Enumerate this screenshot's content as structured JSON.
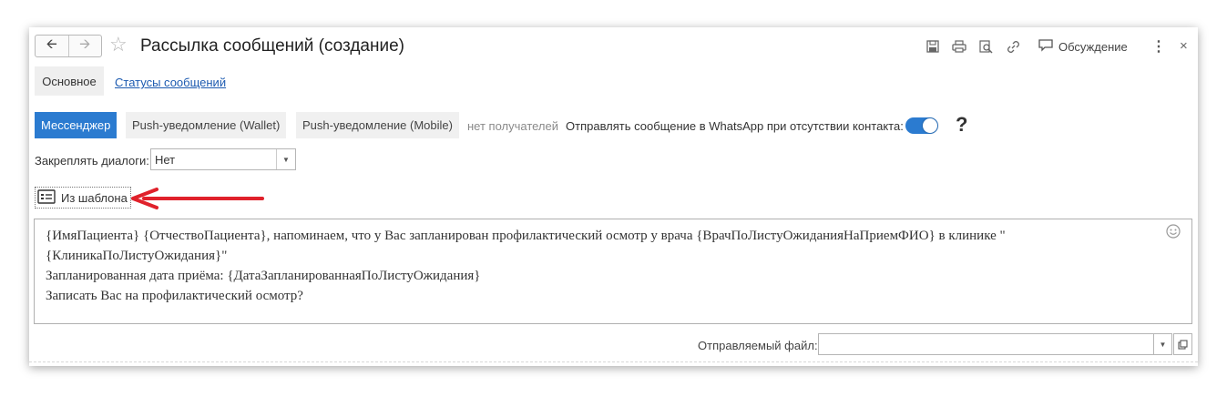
{
  "window": {
    "title": "Рассылка сообщений (создание)",
    "discussion_label": "Обсуждение"
  },
  "tabs": {
    "main": "Основное",
    "statuses": "Статусы сообщений"
  },
  "modes": [
    {
      "label": "Мессенджер",
      "active": true
    },
    {
      "label": "Push-уведомление (Wallet)",
      "active": false
    },
    {
      "label": "Push-уведомление (Mobile)",
      "active": false
    }
  ],
  "recipients_status": "нет получателей",
  "whatsapp": {
    "label": "Отправлять сообщение в WhatsApp при отсутствии контакта:",
    "enabled": true
  },
  "help_label": "?",
  "pin_dialogs": {
    "label": "Закреплять диалоги:",
    "value": "Нет"
  },
  "template_button": "Из шаблона",
  "message_lines": [
    "{ИмяПациента} {ОтчествоПациента}, напоминаем, что у Вас запланирован профилактический осмотр у врача {ВрачПоЛистуОжиданияНаПриемФИО} в клинике \"",
    "{КлиникаПоЛистуОжидания}\"",
    "Запланированная дата приёма: {ДатаЗапланированнаяПоЛистуОжидания}",
    "Записать Вас на профилактический осмотр?"
  ],
  "file": {
    "label": "Отправляемый файл:",
    "value": ""
  },
  "colors": {
    "accent": "#2b7bd0",
    "link": "#1c5ab0",
    "arrow": "#e0212b"
  },
  "icons": [
    "back-arrow-icon",
    "forward-arrow-icon",
    "star-icon",
    "save-icon",
    "print-icon",
    "preview-icon",
    "link-icon",
    "discussion-icon",
    "more-icon",
    "close-icon",
    "template-icon",
    "smile-icon",
    "open-icon"
  ]
}
